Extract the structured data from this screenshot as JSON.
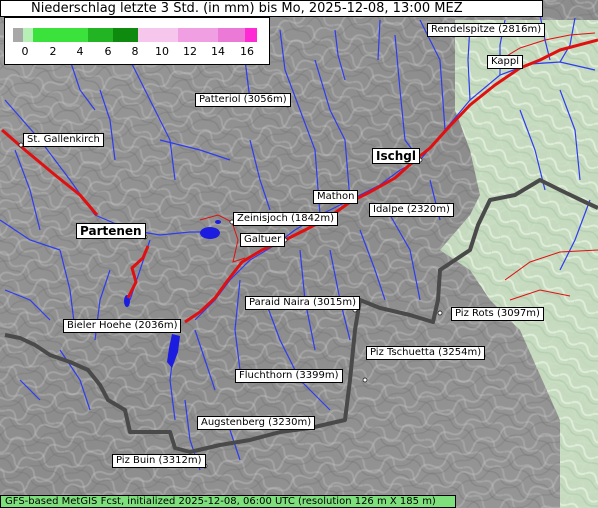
{
  "title": "Niederschlag letzte 3 Std. (in mm) bis Mo, 2025-12-08, 13:00 MEZ",
  "legend": {
    "ticks": [
      "0",
      "2",
      "4",
      "6",
      "8",
      "10",
      "12",
      "14",
      "16"
    ],
    "colors": [
      "#a8a8a8",
      "#b6f0b6",
      "#3ce23c",
      "#22b422",
      "#0e8a0e",
      "#f6c6ec",
      "#f0a0e2",
      "#ea7ad6",
      "#ff2ad4"
    ]
  },
  "places": [
    {
      "id": "rendelspitze",
      "label": "Rendelspitze (2816m)"
    },
    {
      "id": "kappl",
      "label": "Kappl"
    },
    {
      "id": "patteriol",
      "label": "Patteriol (3056m)"
    },
    {
      "id": "st-gallenkirch",
      "label": "St. Gallenkirch"
    },
    {
      "id": "ischgl",
      "label": "Ischgl"
    },
    {
      "id": "mathon",
      "label": "Mathon"
    },
    {
      "id": "idalpe",
      "label": "Idalpe (2320m)"
    },
    {
      "id": "zeinisjoch",
      "label": "Zeinisjoch (1842m)"
    },
    {
      "id": "partenen",
      "label": "Partenen"
    },
    {
      "id": "galtuer",
      "label": "Galtuer"
    },
    {
      "id": "paraid-naira",
      "label": "Paraid Naira (3015m)"
    },
    {
      "id": "piz-rots",
      "label": "Piz Rots (3097m)"
    },
    {
      "id": "bieler-hoehe",
      "label": "Bieler Hoehe (2036m)"
    },
    {
      "id": "piz-tschuetta",
      "label": "Piz Tschuetta (3254m)"
    },
    {
      "id": "fluchthorn",
      "label": "Fluchthorn (3399m)"
    },
    {
      "id": "augstenberg",
      "label": "Augstenberg (3230m)"
    },
    {
      "id": "piz-buin",
      "label": "Piz Buin (3312m)"
    }
  ],
  "footer": "GFS-based MetGIS Fcst, initialized 2025-12-08, 06:00 UTC  (resolution 126 m X 185 m)"
}
